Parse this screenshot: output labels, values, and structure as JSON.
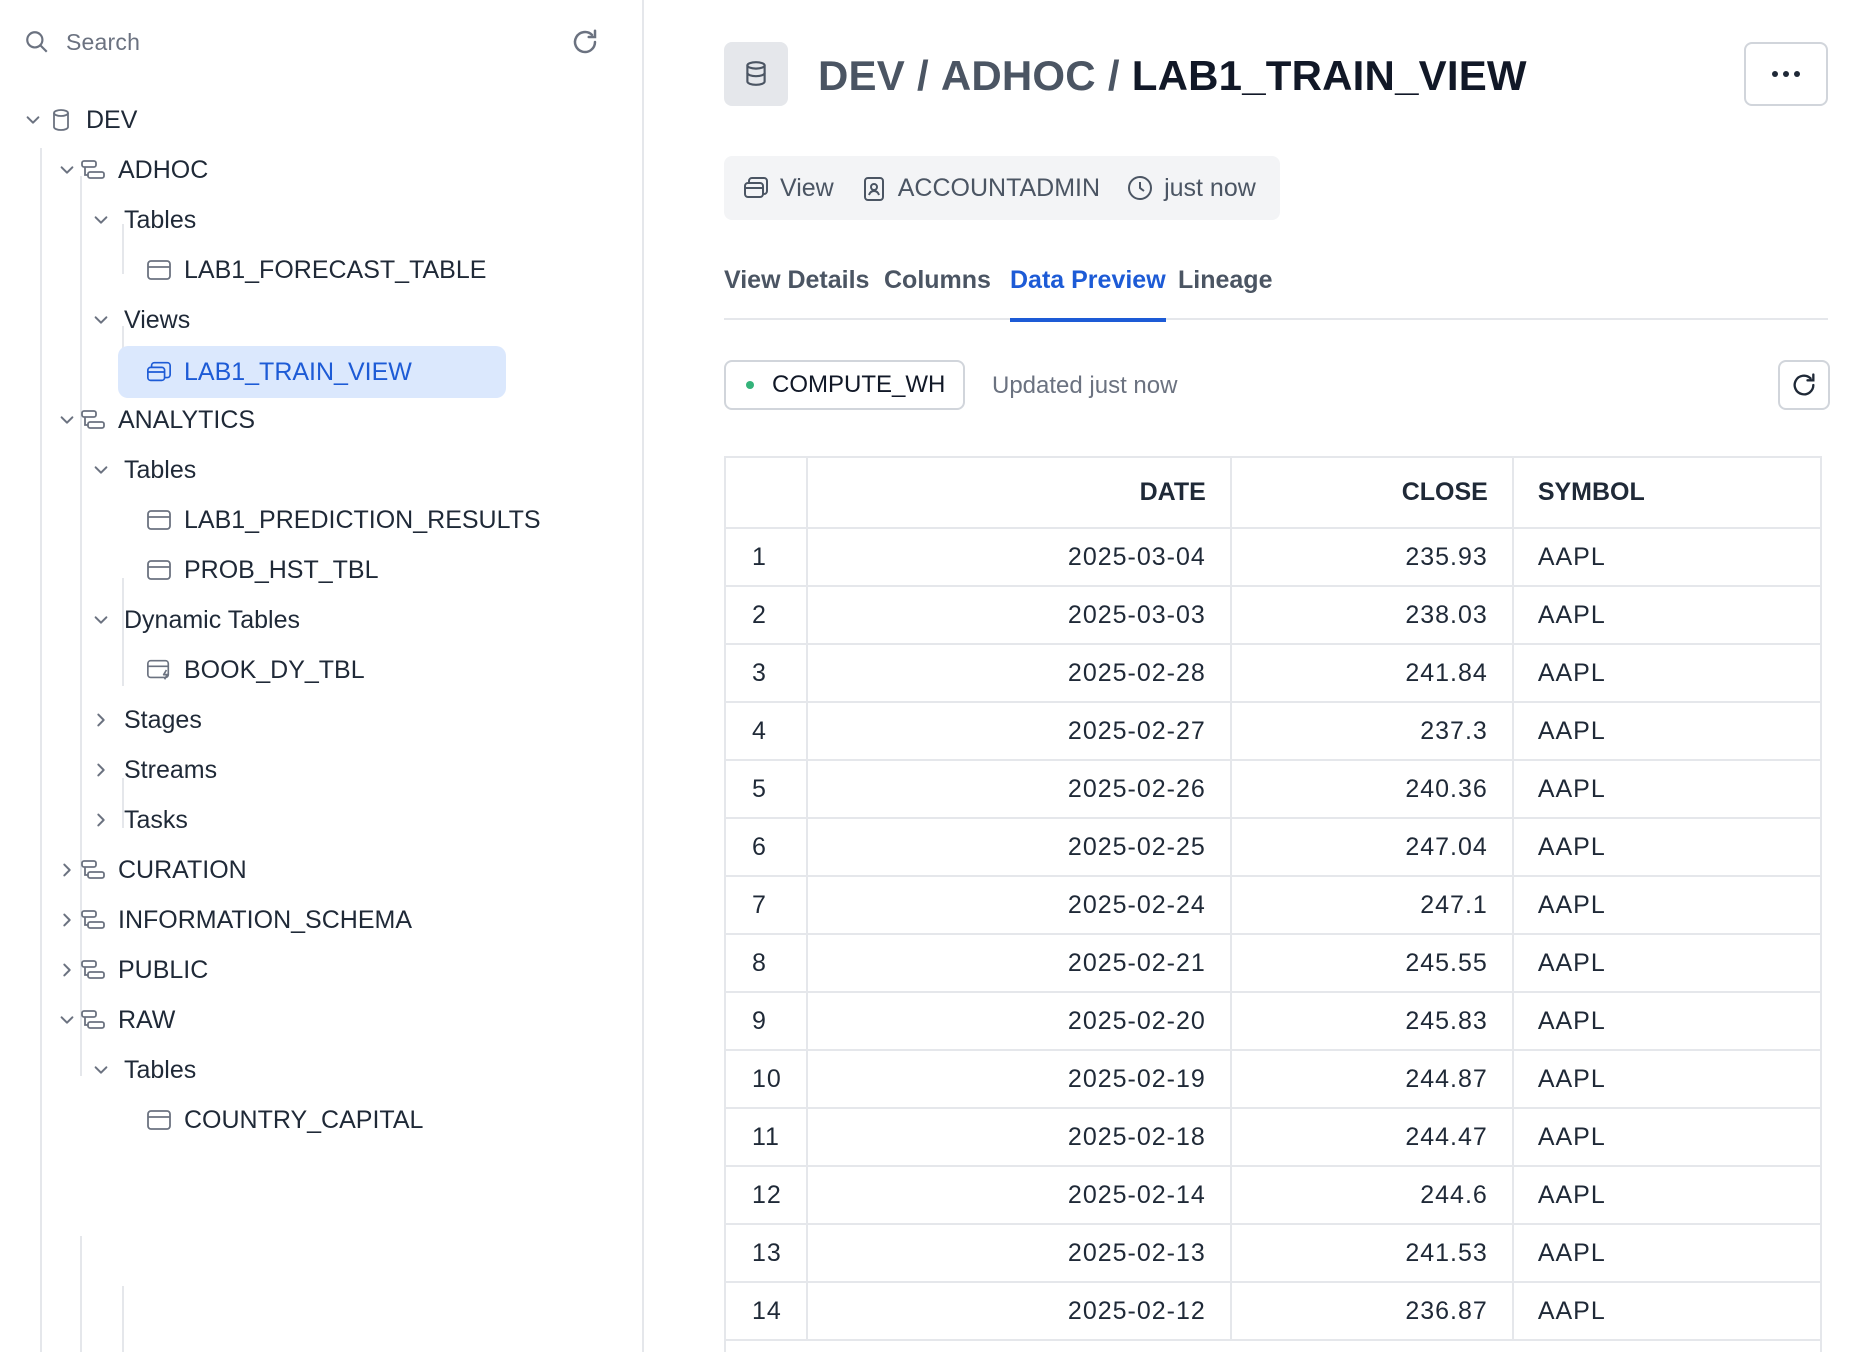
{
  "sidebar": {
    "search": {
      "placeholder": "Search"
    },
    "tree": [
      {
        "label": "DEV",
        "type": "database",
        "expanded": true
      },
      {
        "label": "ADHOC",
        "type": "schema",
        "expanded": true
      },
      {
        "label": "Tables",
        "type": "folder",
        "expanded": true
      },
      {
        "label": "LAB1_FORECAST_TABLE",
        "type": "table"
      },
      {
        "label": "Views",
        "type": "folder",
        "expanded": true
      },
      {
        "label": "LAB1_TRAIN_VIEW",
        "type": "view",
        "selected": true
      },
      {
        "label": "ANALYTICS",
        "type": "schema",
        "expanded": true
      },
      {
        "label": "Tables",
        "type": "folder",
        "expanded": true
      },
      {
        "label": "LAB1_PREDICTION_RESULTS",
        "type": "table"
      },
      {
        "label": "PROB_HST_TBL",
        "type": "table"
      },
      {
        "label": "Dynamic Tables",
        "type": "folder",
        "expanded": true
      },
      {
        "label": "BOOK_DY_TBL",
        "type": "dynamic-table"
      },
      {
        "label": "Stages",
        "type": "folder",
        "expanded": false
      },
      {
        "label": "Streams",
        "type": "folder",
        "expanded": false
      },
      {
        "label": "Tasks",
        "type": "folder",
        "expanded": false
      },
      {
        "label": "CURATION",
        "type": "schema",
        "expanded": false
      },
      {
        "label": "INFORMATION_SCHEMA",
        "type": "schema",
        "expanded": false
      },
      {
        "label": "PUBLIC",
        "type": "schema",
        "expanded": false
      },
      {
        "label": "RAW",
        "type": "schema",
        "expanded": true
      },
      {
        "label": "Tables",
        "type": "folder",
        "expanded": true
      },
      {
        "label": "COUNTRY_CAPITAL",
        "type": "table"
      }
    ]
  },
  "header": {
    "breadcrumb": [
      "DEV",
      "ADHOC"
    ],
    "separator": "/",
    "current": "LAB1_TRAIN_VIEW"
  },
  "meta": {
    "type": "View",
    "owner": "ACCOUNTADMIN",
    "time": "just now"
  },
  "tabs": [
    {
      "label": "View Details",
      "active": false
    },
    {
      "label": "Columns",
      "active": false
    },
    {
      "label": "Data Preview",
      "active": true
    },
    {
      "label": "Lineage",
      "active": false
    }
  ],
  "preview": {
    "warehouse": "COMPUTE_WH",
    "warehouse_status_color": "#34b37a",
    "updated": "Updated just now",
    "columns": [
      "",
      "DATE",
      "CLOSE",
      "SYMBOL"
    ],
    "rows": [
      [
        "1",
        "2025-03-04",
        "235.93",
        "AAPL"
      ],
      [
        "2",
        "2025-03-03",
        "238.03",
        "AAPL"
      ],
      [
        "3",
        "2025-02-28",
        "241.84",
        "AAPL"
      ],
      [
        "4",
        "2025-02-27",
        "237.3",
        "AAPL"
      ],
      [
        "5",
        "2025-02-26",
        "240.36",
        "AAPL"
      ],
      [
        "6",
        "2025-02-25",
        "247.04",
        "AAPL"
      ],
      [
        "7",
        "2025-02-24",
        "247.1",
        "AAPL"
      ],
      [
        "8",
        "2025-02-21",
        "245.55",
        "AAPL"
      ],
      [
        "9",
        "2025-02-20",
        "245.83",
        "AAPL"
      ],
      [
        "10",
        "2025-02-19",
        "244.87",
        "AAPL"
      ],
      [
        "11",
        "2025-02-18",
        "244.47",
        "AAPL"
      ],
      [
        "12",
        "2025-02-14",
        "244.6",
        "AAPL"
      ],
      [
        "13",
        "2025-02-13",
        "241.53",
        "AAPL"
      ],
      [
        "14",
        "2025-02-12",
        "236.87",
        "AAPL"
      ]
    ]
  },
  "colors": {
    "accent": "#1d5bd6",
    "selected_bg": "#dbe8fd",
    "border": "#e5e7eb"
  }
}
